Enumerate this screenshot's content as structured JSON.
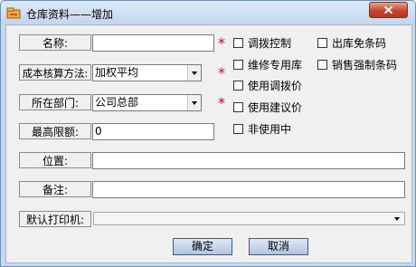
{
  "window": {
    "title": "仓库资料——增加"
  },
  "form": {
    "name": {
      "label": "名称:",
      "value": ""
    },
    "cost_method": {
      "label": "成本核算方法:",
      "value": "加权平均"
    },
    "department": {
      "label": "所在部门:",
      "value": "公司总部"
    },
    "max_limit": {
      "label": "最高限额:",
      "value": "0"
    },
    "location": {
      "label": "位置:",
      "value": ""
    },
    "remark": {
      "label": "备注:",
      "value": ""
    },
    "default_printer": {
      "label": "默认打印机:",
      "value": ""
    }
  },
  "required_mark": "*",
  "checkboxes": {
    "transfer_control": "调拨控制",
    "outbound_no_barcode": "出库免条码",
    "repair_only": "维修专用库",
    "sales_force_barcode": "销售强制条码",
    "use_transfer_price": "使用调拨价",
    "use_suggested_price": "使用建议价",
    "not_in_use": "非使用中"
  },
  "buttons": {
    "ok": "确定",
    "cancel": "取消"
  },
  "colors": {
    "required": "#e0001a",
    "titlebar": "#c7d9ee",
    "close_button": "#c7452a"
  }
}
